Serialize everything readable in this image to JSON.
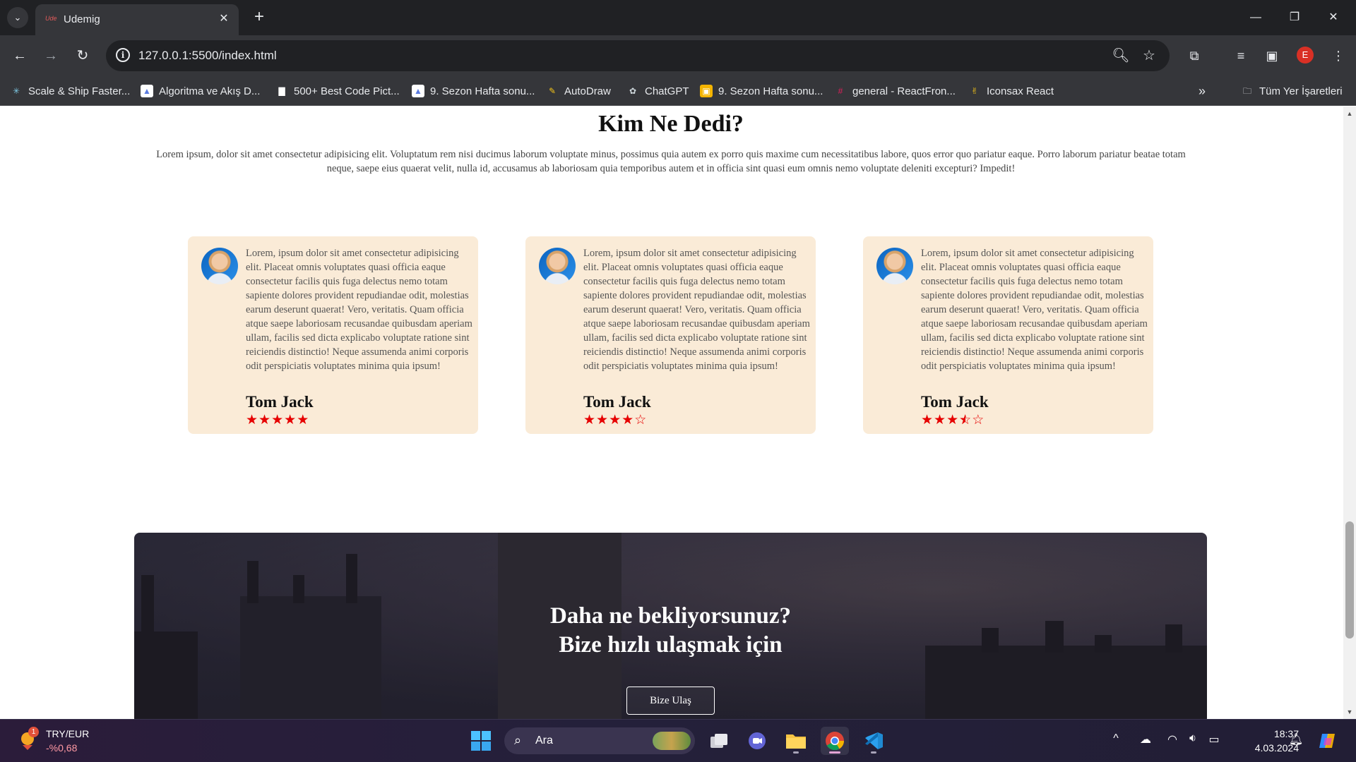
{
  "browser": {
    "tab_title": "Udemig",
    "tab_favicon_text": "Ude",
    "url": "127.0.0.1:5500/index.html",
    "profile_initial": "E",
    "bookmarks": [
      {
        "label": "Scale & Ship Faster...",
        "icon": "star-burst-icon",
        "color": "#7ec8e3"
      },
      {
        "label": "Algoritma ve Akış D...",
        "icon": "doc-icon",
        "color": "#5b7be0"
      },
      {
        "label": "500+ Best Code Pict...",
        "icon": "unsplash-icon",
        "color": "#ffffff"
      },
      {
        "label": "9. Sezon Hafta sonu...",
        "icon": "doc-icon",
        "color": "#5b7be0"
      },
      {
        "label": "AutoDraw",
        "icon": "pencil-icon",
        "color": "#f5c518"
      },
      {
        "label": "ChatGPT",
        "icon": "chatgpt-icon",
        "color": "#cfd8dc"
      },
      {
        "label": "9. Sezon Hafta sonu...",
        "icon": "slides-icon",
        "color": "#f4b400"
      },
      {
        "label": "general - ReactFron...",
        "icon": "slack-icon",
        "color": "#e01e5a"
      },
      {
        "label": "Iconsax React",
        "icon": "victory-hand-icon",
        "color": "#f5c518"
      }
    ],
    "all_bookmarks_label": "Tüm Yer İşaretleri"
  },
  "testimonials": {
    "title": "Kim Ne Dedi?",
    "description": "Lorem ipsum, dolor sit amet consectetur adipisicing elit. Voluptatum rem nisi ducimus laborum voluptate minus, possimus quia autem ex porro quis maxime cum necessitatibus labore, quos error quo pariatur eaque. Porro laborum pariatur beatae totam neque, saepe eius quaerat velit, nulla id, accusamus ab laboriosam quia temporibus autem et in officia sint quasi eum omnis nemo voluptate deleniti excepturi? Impedit!",
    "cards": [
      {
        "text": "Lorem, ipsum dolor sit amet consectetur adipisicing elit. Placeat omnis voluptates quasi officia eaque consectetur facilis quis fuga delectus nemo totam sapiente dolores provident repudiandae odit, molestias earum deserunt quaerat! Vero, veritatis. Quam officia atque saepe laboriosam recusandae quibusdam aperiam ullam, facilis sed dicta explicabo voluptate ratione sint reiciendis distinctio! Neque assumenda animi corporis odit perspiciatis voluptates minima quia ipsum!",
        "name": "Tom Jack",
        "rating": 5
      },
      {
        "text": "Lorem, ipsum dolor sit amet consectetur adipisicing elit. Placeat omnis voluptates quasi officia eaque consectetur facilis quis fuga delectus nemo totam sapiente dolores provident repudiandae odit, molestias earum deserunt quaerat! Vero, veritatis. Quam officia atque saepe laboriosam recusandae quibusdam aperiam ullam, facilis sed dicta explicabo voluptate ratione sint reiciendis distinctio! Neque assumenda animi corporis odit perspiciatis voluptates minima quia ipsum!",
        "name": "Tom Jack",
        "rating": 4
      },
      {
        "text": "Lorem, ipsum dolor sit amet consectetur adipisicing elit. Placeat omnis voluptates quasi officia eaque consectetur facilis quis fuga delectus nemo totam sapiente dolores provident repudiandae odit, molestias earum deserunt quaerat! Vero, veritatis. Quam officia atque saepe laboriosam recusandae quibusdam aperiam ullam, facilis sed dicta explicabo voluptate ratione sint reiciendis distinctio! Neque assumenda animi corporis odit perspiciatis voluptates minima quia ipsum!",
        "name": "Tom Jack",
        "rating": 3.5
      }
    ],
    "star_color": "#e60000",
    "card_color": "#faebd7"
  },
  "cta": {
    "line1": "Daha ne bekliyorsunuz?",
    "line2": "Bize hızlı ulaşmak için",
    "button": "Bize Ulaş"
  },
  "taskbar": {
    "ticker_name": "TRY/EUR",
    "ticker_value": "-%0,68",
    "weather_badge": "1",
    "search_label": "Ara",
    "time": "18:37",
    "date": "4.03.2024"
  }
}
